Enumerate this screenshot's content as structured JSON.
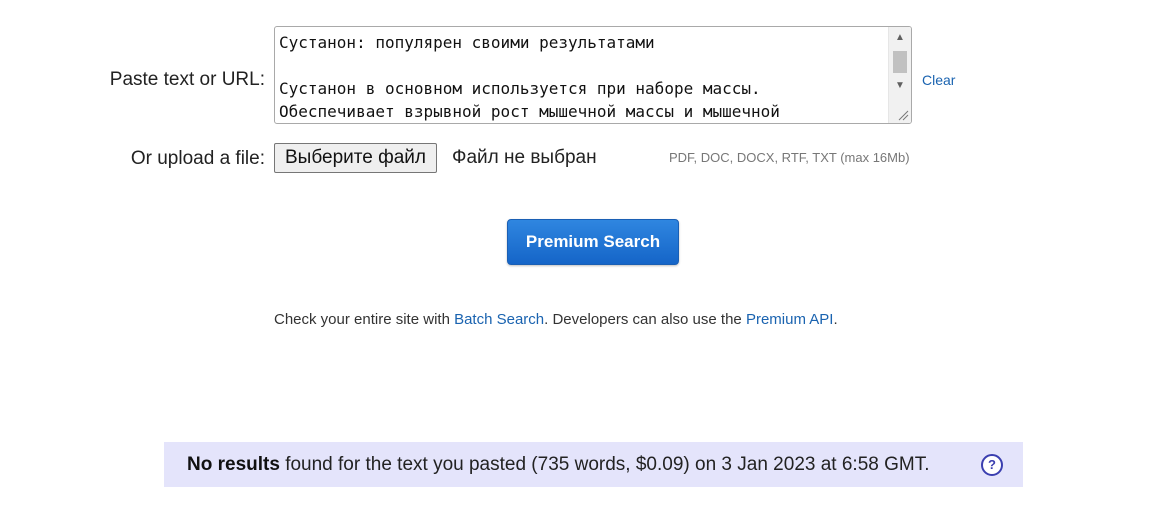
{
  "form": {
    "paste_label": "Paste text or URL:",
    "text_lines": [
      "Сустанон: популярен своими результатами",
      "",
      "Сустанон в основном используется при наборе массы.",
      "Обеспечивает взрывной рост мышечной массы и мышечной"
    ],
    "clear_label": "Clear",
    "upload_label": "Or upload a file:",
    "file_button_label": "Выберите файл",
    "file_status": "Файл не выбран",
    "file_types": "PDF, DOC, DOCX, RTF, TXT (max 16Mb)"
  },
  "search_button_label": "Premium Search",
  "info": {
    "prefix": "Check your entire site with ",
    "batch_link": "Batch Search",
    "middle": ". Developers can also use the ",
    "api_link": "Premium API",
    "suffix": "."
  },
  "result": {
    "bold": "No results",
    "text": " found for the text you pasted (735 words, $0.09) on 3 Jan 2023 at 6:58 GMT.",
    "help_icon": "help-question-icon",
    "help_glyph": "?"
  },
  "colors": {
    "accent_link": "#1a63b0",
    "button_blue": "#1565c8",
    "result_bg": "#e4e4fb"
  }
}
